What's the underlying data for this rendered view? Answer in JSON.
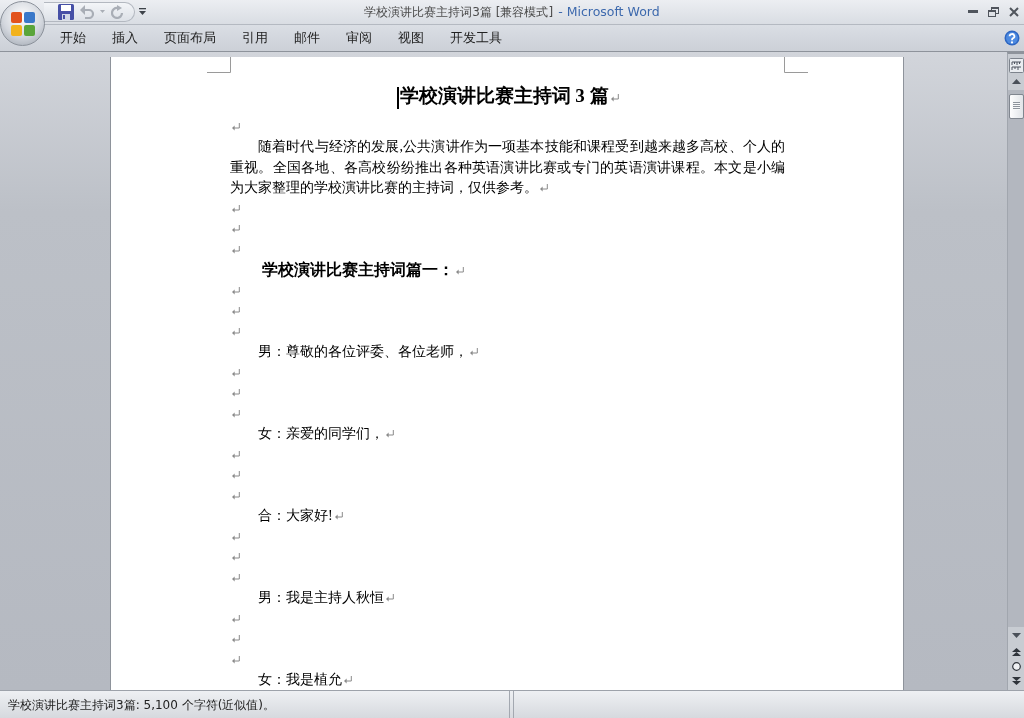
{
  "title_bar": {
    "document_title": "学校演讲比赛主持词3篇 [兼容模式]",
    "app_name": "- Microsoft Word"
  },
  "quick_access_toolbar": [
    {
      "kind": "save",
      "disabled": false
    },
    {
      "kind": "undo",
      "disabled": true
    },
    {
      "kind": "redo",
      "disabled": true
    },
    {
      "kind": "customize",
      "disabled": false
    }
  ],
  "ribbon_tabs": [
    {
      "label": "开始",
      "selected": false
    },
    {
      "label": "插入",
      "selected": false
    },
    {
      "label": "页面布局",
      "selected": false
    },
    {
      "label": "引用",
      "selected": false
    },
    {
      "label": "邮件",
      "selected": false
    },
    {
      "label": "审阅",
      "selected": false
    },
    {
      "label": "视图",
      "selected": false
    },
    {
      "label": "开发工具",
      "selected": false
    }
  ],
  "document": {
    "paragraphs": [
      {
        "kind": "title",
        "text": "学校演讲比赛主持词 3 篇"
      },
      {
        "kind": "empty"
      },
      {
        "kind": "body",
        "text": "随着时代与经济的发展,公共演讲作为一项基本技能和课程受到越来越多高校、个人的重视。全国各地、各高校纷纷推出各种英语演讲比赛或专门的英语演讲课程。本文是小编为大家整理的学校演讲比赛的主持词，仅供参考。"
      },
      {
        "kind": "empty"
      },
      {
        "kind": "empty"
      },
      {
        "kind": "empty"
      },
      {
        "kind": "heading",
        "text": "学校演讲比赛主持词篇一："
      },
      {
        "kind": "empty"
      },
      {
        "kind": "empty"
      },
      {
        "kind": "empty"
      },
      {
        "kind": "line",
        "text": "男：尊敬的各位评委、各位老师，"
      },
      {
        "kind": "empty"
      },
      {
        "kind": "empty"
      },
      {
        "kind": "empty"
      },
      {
        "kind": "line",
        "text": "女：亲爱的同学们，"
      },
      {
        "kind": "empty"
      },
      {
        "kind": "empty"
      },
      {
        "kind": "empty"
      },
      {
        "kind": "line",
        "text": "合：大家好!"
      },
      {
        "kind": "empty"
      },
      {
        "kind": "empty"
      },
      {
        "kind": "empty"
      },
      {
        "kind": "line",
        "text": "男：我是主持人秋恒"
      },
      {
        "kind": "empty"
      },
      {
        "kind": "empty"
      },
      {
        "kind": "empty"
      },
      {
        "kind": "line",
        "text": "女：我是植允"
      }
    ]
  },
  "status_bar": {
    "text": "学校演讲比赛主持词3篇: 5,100 个字符(近似值)。"
  }
}
